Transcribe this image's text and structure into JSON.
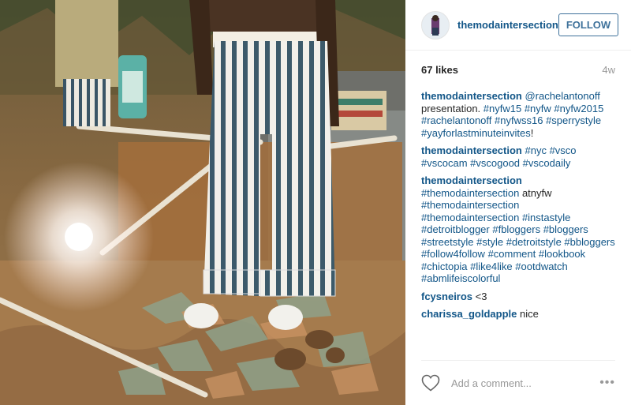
{
  "post": {
    "username": "themodaintersection",
    "follow_label": "FOLLOW",
    "likes": "67 likes",
    "age": "4w",
    "add_comment_placeholder": "Add a comment...",
    "more_label": "•••",
    "heart_icon": "heart-outline-icon"
  },
  "colors": {
    "link": "#125688",
    "follow_border": "#3f729b",
    "muted": "#999999"
  },
  "comments": [
    {
      "user": "themodaintersection",
      "tokens": [
        "@rachelantonoff",
        " presentation. ",
        "#nyfw15",
        " ",
        "#nyfw",
        " ",
        "#nyfw2015",
        " ",
        "#rachelantonoff",
        " ",
        "#nyfwss16",
        " ",
        "#sperrystyle",
        " ",
        "#yayforlastminuteinvites",
        "!"
      ]
    },
    {
      "user": "themodaintersection",
      "tokens": [
        "#nyc",
        " ",
        "#vsco",
        " ",
        "#vscocam",
        " ",
        "#vscogood",
        " ",
        "#vscodaily"
      ]
    },
    {
      "user": "themodaintersection",
      "tokens": [
        "#themodaintersection",
        " ",
        "atnyfw",
        " ",
        "#themodaintersection",
        " ",
        "#themodaintersection",
        " ",
        "#instastyle",
        " ",
        "#detroitblogger",
        " ",
        "#fbloggers",
        " ",
        "#bloggers",
        " ",
        "#streetstyle",
        " ",
        "#style",
        " ",
        "#detroitstyle",
        " ",
        "#bbloggers",
        " ",
        "#follow4follow",
        " ",
        "#comment",
        " ",
        "#lookbook",
        " ",
        "#chictopia",
        " ",
        "#like4like",
        " ",
        "#ootdwatch",
        " ",
        "#abmlifeiscolorful"
      ]
    },
    {
      "user": "fcysneiros",
      "tokens": [
        "<3"
      ]
    },
    {
      "user": "charissa_goldapple",
      "tokens": [
        "nice"
      ]
    }
  ]
}
